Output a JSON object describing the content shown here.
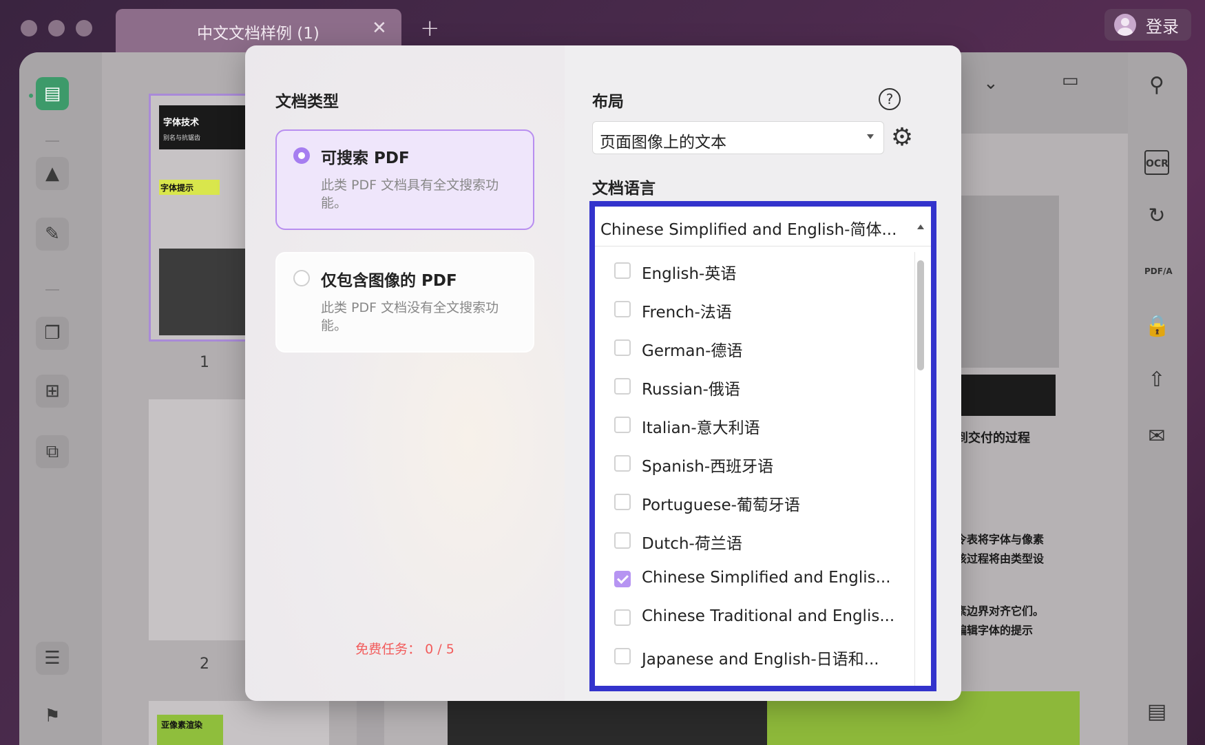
{
  "titlebar": {
    "tab_title": "中文文档样例 (1)",
    "tab_close": "✕",
    "tab_add": "+",
    "login_label": "登录"
  },
  "thumbnails": {
    "page1_num": "1",
    "page2_num": "2",
    "page1_heading": "字体技术",
    "page1_subheading": "别名与抗锯齿",
    "page1_section": "字体提示",
    "page3_heading": "亚像素渲染"
  },
  "document_bg": {
    "line1": "到交付的过程",
    "line2": "令表将字体与像素",
    "line3": "该过程将由类型设",
    "line4": "素边界对齐它们。",
    "line5": "编辑字体的提示"
  },
  "dialog": {
    "doc_type_label": "文档类型",
    "option_searchable": {
      "title": "可搜索 PDF",
      "desc": "此类 PDF 文档具有全文搜索功能。",
      "selected": true
    },
    "option_image_only": {
      "title": "仅包含图像的 PDF",
      "desc": "此类 PDF 文档没有全文搜索功能。",
      "selected": false
    },
    "free_tasks": "免费任务： 0 / 5",
    "layout_label": "布局",
    "layout_value": "页面图像上的文本",
    "help_icon": "?",
    "language_label": "文档语言",
    "language_value": "Chinese Simplified and English-简体...",
    "languages": [
      {
        "label": "English-英语",
        "checked": false
      },
      {
        "label": "French-法语",
        "checked": false
      },
      {
        "label": "German-德语",
        "checked": false
      },
      {
        "label": "Russian-俄语",
        "checked": false
      },
      {
        "label": "Italian-意大利语",
        "checked": false
      },
      {
        "label": "Spanish-西班牙语",
        "checked": false
      },
      {
        "label": "Portuguese-葡萄牙语",
        "checked": false
      },
      {
        "label": "Dutch-荷兰语",
        "checked": false
      },
      {
        "label": "Chinese Simplified and Englis...",
        "checked": true
      },
      {
        "label": "Chinese Traditional and Englis...",
        "checked": false
      },
      {
        "label": "Japanese and English-日语和...",
        "checked": false
      }
    ]
  },
  "colors": {
    "accent": "#a67ef0",
    "focus_border": "#3333cc",
    "warning_text": "#f25b5b",
    "active_tool": "#3d9a6a"
  }
}
